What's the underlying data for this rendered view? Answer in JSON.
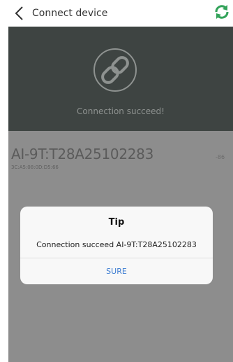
{
  "header": {
    "title": "Connect device",
    "back_icon": "chevron-left-icon",
    "refresh_icon": "refresh-icon",
    "accent_color": "#33a35a"
  },
  "status": {
    "icon": "link-icon",
    "text": "Connection succeed!"
  },
  "device": {
    "name": "AI-9T:T28A25102283",
    "mac": "3C:A5:08:0D:D5:66",
    "rssi": "-86"
  },
  "dialog": {
    "title": "Tip",
    "message": "Connection succeed AI-9T:T28A25102283",
    "button_label": "SURE",
    "button_color": "#3b7bd1"
  }
}
